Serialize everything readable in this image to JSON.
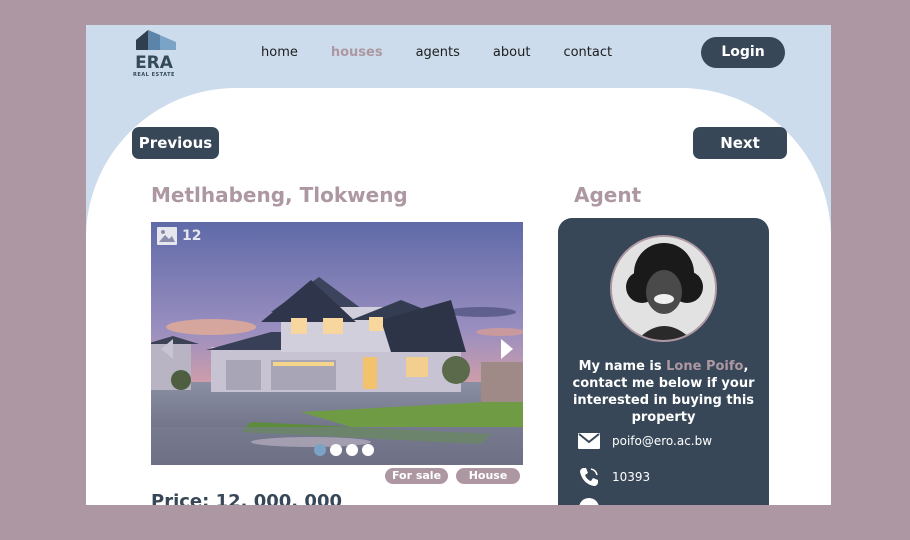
{
  "brand": {
    "name": "ERA",
    "tagline": "REAL ESTATE"
  },
  "nav": [
    "home",
    "houses",
    "agents",
    "about",
    "contact"
  ],
  "nav_active": "houses",
  "login_label": "Login",
  "pager": {
    "prev": "Previous",
    "next": "Next"
  },
  "listing": {
    "location": "Metlhabeng, Tlokweng",
    "photo_count": "12",
    "photo_dots": 4,
    "photo_active_index": 0,
    "tags": [
      "For sale",
      "House"
    ],
    "price": "Price: 12, 000, 000"
  },
  "agent": {
    "heading": "Agent",
    "intro": "My name is ",
    "name": "Lone Poifo",
    "message": ", contact me below if your interested in buying this property",
    "email": "poifo@ero.ac.bw",
    "phone": "10393"
  },
  "colors": {
    "page_bg": "#ad97a2",
    "header_bg": "#ccdcec",
    "dark": "#374757",
    "accent": "#ad97a2"
  }
}
